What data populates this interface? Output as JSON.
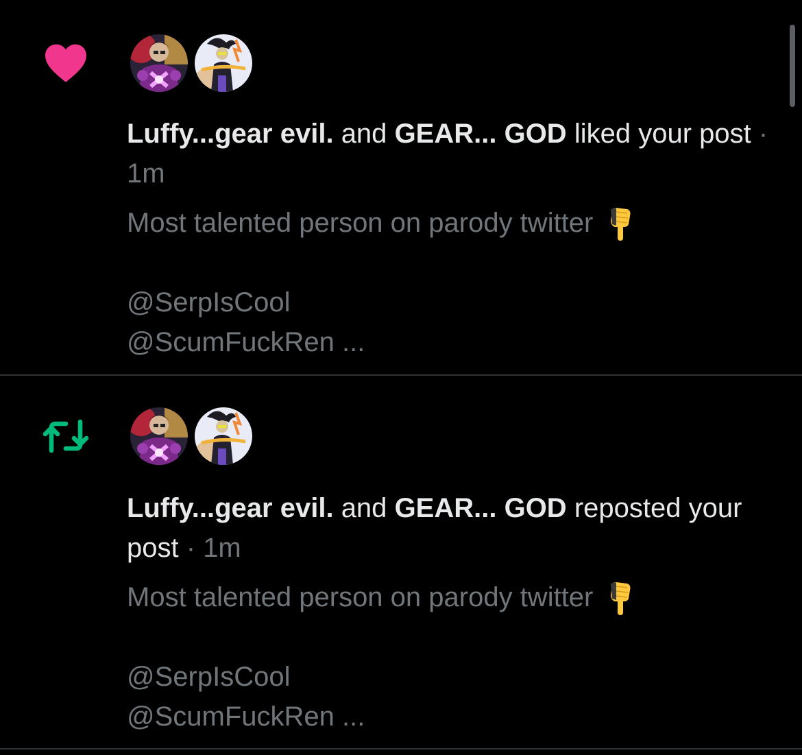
{
  "notifications": [
    {
      "type": "like",
      "icon": "heart-icon",
      "icon_color": "#f0378d",
      "actor_1": "Luffy...gear evil.",
      "joiner": "and",
      "actor_2": "GEAR... GOD",
      "action": "liked your post",
      "separator": "·",
      "time": "1m",
      "post_text": "Most talented person on parody twitter",
      "post_emoji": "backhand-pointing-down-emoji",
      "mention_1": "@SerpIsCool",
      "mention_2": "@ScumFuckRen ..."
    },
    {
      "type": "repost",
      "icon": "repost-icon",
      "icon_color": "#00ba7c",
      "actor_1": "Luffy...gear evil.",
      "joiner": "and",
      "actor_2": "GEAR... GOD",
      "action": "reposted your post",
      "separator": "·",
      "time": "1m",
      "post_text": "Most talented person on parody twitter",
      "post_emoji": "backhand-pointing-down-emoji",
      "mention_1": "@SerpIsCool",
      "mention_2": "@ScumFuckRen ..."
    }
  ],
  "colors": {
    "background": "#000000",
    "primary_text": "#e7e9ea",
    "secondary_text": "#71767b",
    "divider": "#2f3336",
    "like": "#f0378d",
    "repost": "#00ba7c"
  }
}
